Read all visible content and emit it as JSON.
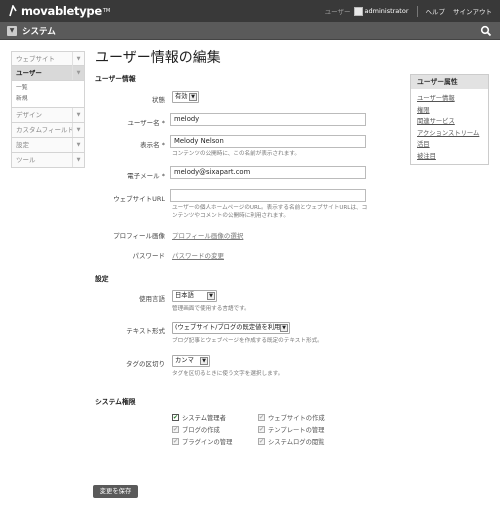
{
  "topbar": {
    "logo_text": "movabletype",
    "logo_tm": "TM",
    "user_label": "ユーザー",
    "username": "administrator",
    "help": "ヘルプ",
    "signout": "サインアウト"
  },
  "scope": {
    "title": "システム"
  },
  "leftmenu": {
    "website": "ウェブサイト",
    "user": "ユーザー",
    "user_sub": [
      "一覧",
      "新規"
    ],
    "design": "デザイン",
    "custom_fields": "カスタムフィールド",
    "settings": "設定",
    "tools": "ツール"
  },
  "page": {
    "title": "ユーザー情報の編集"
  },
  "user_info": {
    "section": "ユーザー情報",
    "status_label": "状態",
    "status_value": "有効",
    "username_label": "ユーザー名 *",
    "username_value": "melody",
    "display_name_label": "表示名 *",
    "display_name_value": "Melody Nelson",
    "display_name_help": "コンテンツの公開時に、この名前が表示されます。",
    "email_label": "電子メール *",
    "email_value": "melody@sixapart.com",
    "website_url_label": "ウェブサイトURL",
    "website_url_value": "",
    "website_url_help": "ユーザーの個人ホームページのURL。表示する名前とウェブサイトURLは、コンテンツやコメントの公開時に利用されます。",
    "profile_image_label": "プロフィール画像",
    "profile_image_link": "プロフィール画像の選択",
    "password_label": "パスワード",
    "password_link": "パスワードの変更"
  },
  "settings": {
    "section": "設定",
    "language_label": "使用言語",
    "language_value": "日本語",
    "language_help": "管理画面で使用する言語です。",
    "text_format_label": "テキスト形式",
    "text_format_value": "(ウェブサイト/ブログの既定値を利用)",
    "text_format_help": "ブログ記事とウェブページを作成する既定のテキスト形式。",
    "tag_delim_label": "タグの区切り",
    "tag_delim_value": "カンマ",
    "tag_delim_help": "タグを区切るときに使う文字を選択します。"
  },
  "permissions": {
    "section": "システム権限",
    "items": [
      {
        "label": "システム管理者",
        "checked": true
      },
      {
        "label": "ウェブサイトの作成",
        "checked": false
      },
      {
        "label": "ブログの作成",
        "checked": false
      },
      {
        "label": "テンプレートの管理",
        "checked": false
      },
      {
        "label": "プラグインの管理",
        "checked": false
      },
      {
        "label": "システムログの閲覧",
        "checked": false
      }
    ]
  },
  "actions": {
    "save": "変更を保存"
  },
  "sidebar": {
    "title": "ユーザー属性",
    "items": [
      "ユーザー情報",
      "権限",
      "関連サービス",
      "アクションストリーム",
      "活目",
      "被注目"
    ]
  },
  "colors": {
    "topbar": "#393939",
    "scopebar": "#5a5a5a",
    "save_button": "#5a5a5a",
    "check_green": "#2a7a2a"
  },
  "icons": [
    "logo-mark-icon",
    "scope-toggle-icon",
    "search-icon",
    "chevron-down-icon",
    "checkmark-icon"
  ]
}
